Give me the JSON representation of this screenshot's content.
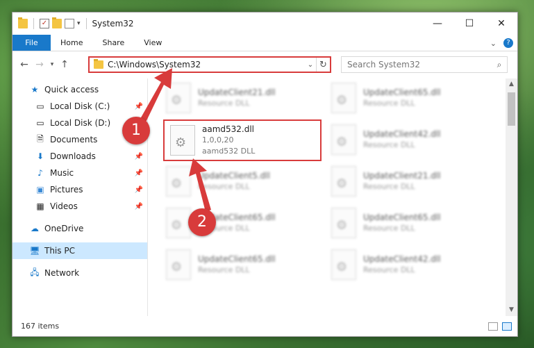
{
  "window": {
    "title": "System32",
    "controls": {
      "minimize": "—",
      "maximize": "☐",
      "close": "✕"
    }
  },
  "ribbon": {
    "file": "File",
    "tabs": [
      "Home",
      "Share",
      "View"
    ]
  },
  "nav": {
    "address": "C:\\Windows\\System32",
    "search_placeholder": "Search System32"
  },
  "sidebar": {
    "items": [
      {
        "label": "Quick access",
        "icon": "star-icon"
      },
      {
        "label": "Local Disk (C:)",
        "icon": "drive-icon"
      },
      {
        "label": "Local Disk (D:)",
        "icon": "drive-icon"
      },
      {
        "label": "Documents",
        "icon": "documents-icon"
      },
      {
        "label": "Downloads",
        "icon": "download-icon"
      },
      {
        "label": "Music",
        "icon": "music-icon"
      },
      {
        "label": "Pictures",
        "icon": "pictures-icon"
      },
      {
        "label": "Videos",
        "icon": "videos-icon"
      },
      {
        "label": "OneDrive",
        "icon": "cloud-icon"
      },
      {
        "label": "This PC",
        "icon": "computer-icon"
      },
      {
        "label": "Network",
        "icon": "network-icon"
      }
    ]
  },
  "files": {
    "highlighted": {
      "name": "aamd532.dll",
      "version": "1,0,0,20",
      "type": "aamd532 DLL"
    },
    "blurred": [
      {
        "name": "UpdateClient21.dll",
        "type": "Resource DLL"
      },
      {
        "name": "UpdateClient65.dll",
        "type": "Resource DLL"
      },
      {
        "name": "UpdateClient42.dll",
        "type": "Resource DLL"
      },
      {
        "name": "UpdateClient5.dll",
        "type": "Resource DLL"
      },
      {
        "name": "UpdateClient21.dll",
        "type": "Resource DLL"
      },
      {
        "name": "UpdateClient65.dll",
        "type": "Resource DLL"
      },
      {
        "name": "UpdateClient65.dll",
        "type": "Resource DLL"
      },
      {
        "name": "UpdateClient65.dll",
        "type": "Resource DLL"
      },
      {
        "name": "UpdateClient42.dll",
        "type": "Resource DLL"
      }
    ]
  },
  "status": {
    "count": "167 items"
  },
  "annotations": {
    "step1": "1",
    "step2": "2"
  },
  "colors": {
    "accent": "#1979ca",
    "highlight": "#d83b3b",
    "selected": "#cce8ff"
  }
}
